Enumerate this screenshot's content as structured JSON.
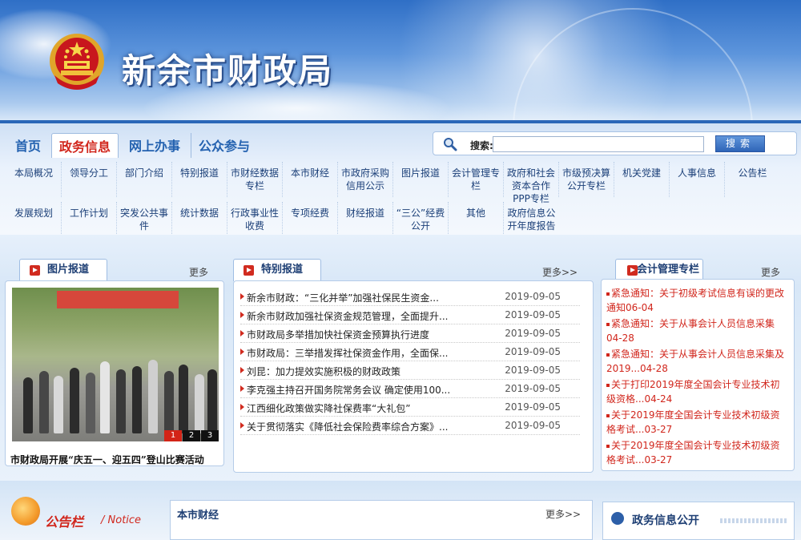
{
  "header": {
    "site_title": "新余市财政局"
  },
  "nav": {
    "main_tabs": [
      {
        "label": "首页"
      },
      {
        "label": "政务信息"
      },
      {
        "label": "网上办事"
      },
      {
        "label": "公众参与"
      }
    ],
    "search": {
      "label": "搜索:",
      "button": "搜索"
    },
    "sub_row1": [
      "本局概况",
      "领导分工",
      "部门介绍",
      "特别报道",
      "市财经数据专栏",
      "本市财经",
      "市政府采购信用公示",
      "图片报道",
      "会计管理专栏",
      "政府和社会资本合作PPP专栏",
      "市级预决算公开专栏",
      "机关党建",
      "人事信息",
      "公告栏"
    ],
    "sub_row2": [
      "发展规划",
      "工作计划",
      "突发公共事件",
      "统计数据",
      "行政事业性收费",
      "专项经费",
      "财经报道",
      "“三公”经费公开",
      "其他",
      "政府信息公开年度报告"
    ]
  },
  "photo_panel": {
    "title": "图片报道",
    "more": "更多>>",
    "caption": "市财政局开展“庆五一、迎五四”登山比赛活动",
    "pager": [
      "1",
      "2",
      "3"
    ]
  },
  "special_panel": {
    "title": "特别报道",
    "more": "更多>>",
    "items": [
      {
        "title": "新余市财政：“三化并举”加强社保民生资金...",
        "date": "2019-09-05"
      },
      {
        "title": "新余市财政加强社保资金规范管理，全面提升...",
        "date": "2019-09-05"
      },
      {
        "title": "市财政局多举措加快社保资金预算执行进度",
        "date": "2019-09-05"
      },
      {
        "title": "市财政局：三举措发挥社保资金作用，全面保...",
        "date": "2019-09-05"
      },
      {
        "title": "刘昆：加力提效实施积极的财政政策",
        "date": "2019-09-05"
      },
      {
        "title": "李克强主持召开国务院常务会议 确定使用100...",
        "date": "2019-09-05"
      },
      {
        "title": "江西细化政策做实降社保费率“大礼包”",
        "date": "2019-09-05"
      },
      {
        "title": "关于贯彻落实《降低社会保险费率综合方案》...",
        "date": "2019-09-05"
      }
    ]
  },
  "accounting_panel": {
    "title": "会计管理专栏",
    "more": "更多>>",
    "items": [
      "紧急通知：关于初级考试信息有误的更改通知06-04",
      "紧急通知：关于从事会计人员信息采集04-28",
      "紧急通知：关于从事会计人员信息采集及2019...04-28",
      "关于打印2019年度全国会计专业技术初级资格...04-24",
      "关于2019年度全国会计专业技术初级资格考试...03-27",
      "关于2019年度全国会计专业技术初级资格考试...03-27"
    ]
  },
  "lower": {
    "notice_title": "公告栏",
    "notice_sub": "/ Notice",
    "mid_title": "本市财经",
    "mid_more": "更多>>",
    "right_title": "政务信息公开"
  }
}
